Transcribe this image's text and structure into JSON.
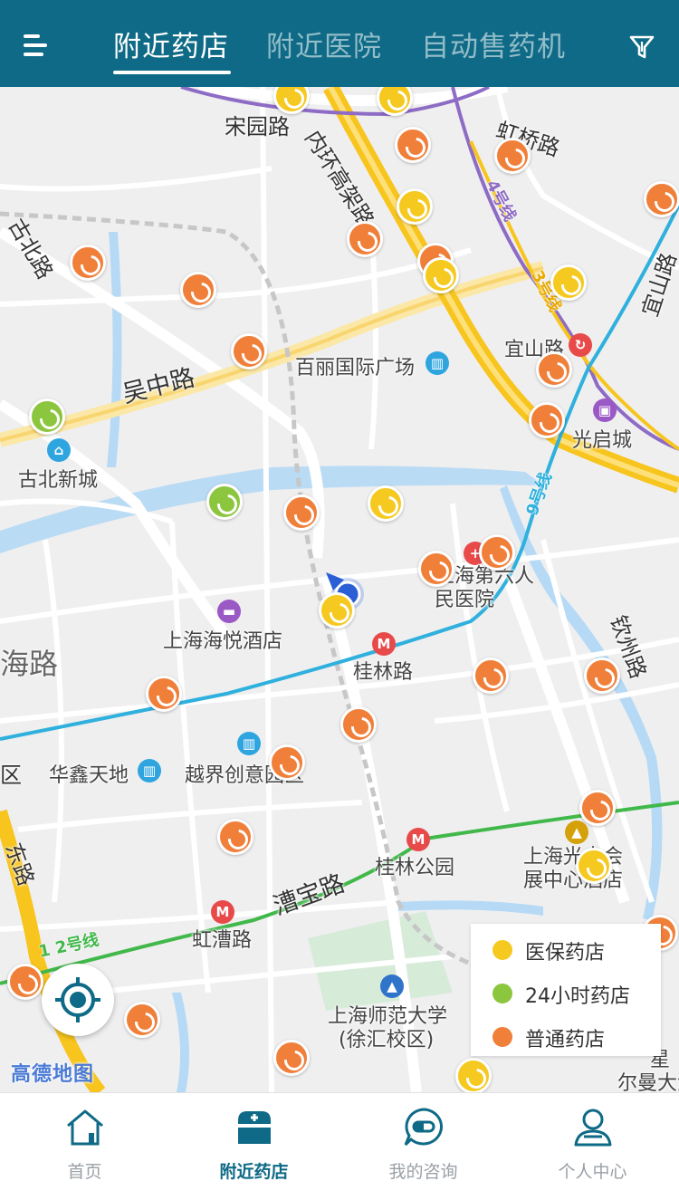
{
  "header": {
    "tabs": [
      {
        "label": "附近药店",
        "active": true
      },
      {
        "label": "附近医院",
        "active": false
      },
      {
        "label": "自动售药机",
        "active": false
      }
    ],
    "menu_icon": "menu-icon",
    "filter_icon": "filter-icon",
    "color": "#0e6a86"
  },
  "map": {
    "roads": [
      "宋园路",
      "内环高架路",
      "虹桥路",
      "宜山路",
      "吴中路",
      "古北路",
      "海路",
      "钦州路",
      "漕宝路",
      "东路",
      "区"
    ],
    "metro": [
      "4号线",
      "3号线",
      "9号线",
      "1 2号线"
    ],
    "places": [
      "百丽国际广场",
      "宜山路",
      "光启城",
      "古北新城",
      "上海第六人民医院",
      "上海海悦酒店",
      "桂林路",
      "华鑫天地",
      "越界创意园区",
      "桂林公园",
      "上海光大会展中心酒店",
      "虹漕路",
      "上海师范大学",
      "(徐汇校区)",
      "星",
      "尔曼大酒"
    ],
    "logo": "高德地图",
    "locate_icon": "locate-icon",
    "colors": {
      "orange": "#f07f3a",
      "yellow": "#f5c920",
      "green": "#8cc63f"
    }
  },
  "legend": [
    {
      "label": "医保药店",
      "color": "#f5c920"
    },
    {
      "label": "24小时药店",
      "color": "#8cc63f"
    },
    {
      "label": "普通药店",
      "color": "#f07f3a"
    }
  ],
  "bottom_nav": [
    {
      "label": "首页",
      "icon": "home-icon",
      "active": false
    },
    {
      "label": "附近药店",
      "icon": "pharmacy-icon",
      "active": true
    },
    {
      "label": "我的咨询",
      "icon": "consult-icon",
      "active": false
    },
    {
      "label": "个人中心",
      "icon": "user-icon",
      "active": false
    }
  ]
}
